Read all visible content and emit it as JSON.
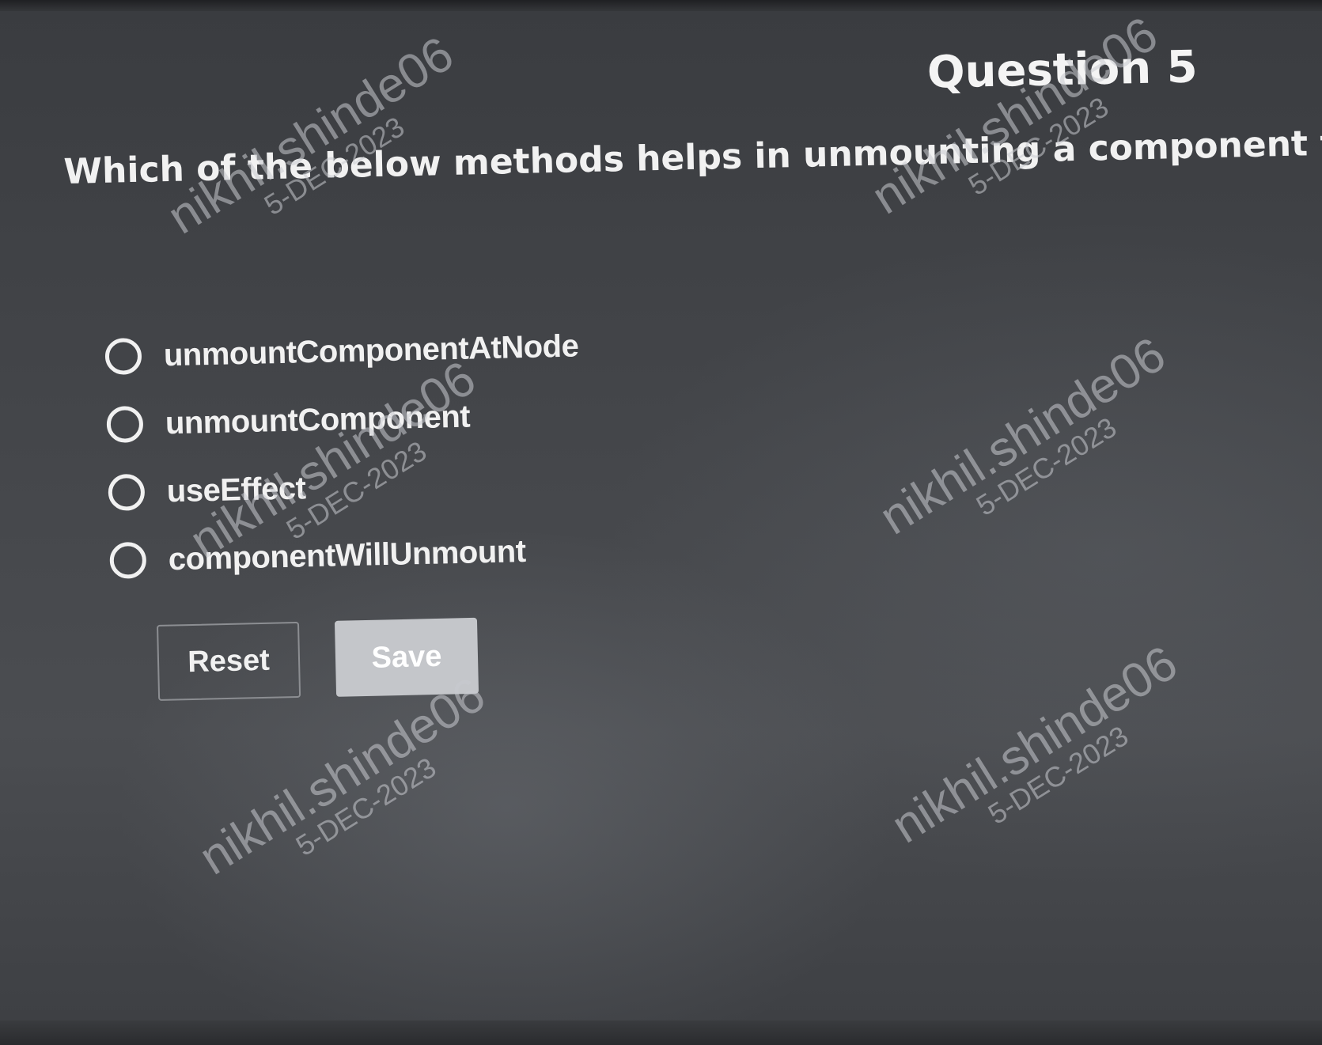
{
  "question": {
    "heading": "Question 5",
    "text": "Which of the below methods helps in unmounting a component from the DOM"
  },
  "options": [
    {
      "label": "unmountComponentAtNode",
      "selected": false
    },
    {
      "label": "unmountComponent",
      "selected": false
    },
    {
      "label": "useEffect",
      "selected": false
    },
    {
      "label": "componentWillUnmount",
      "selected": false
    }
  ],
  "buttons": {
    "reset_label": "Reset",
    "save_label": "Save"
  },
  "watermark": {
    "name": "nikhil.shinde06",
    "date": "5-DEC-2023"
  },
  "colors": {
    "background": "#45474b",
    "text": "#f1f1f1",
    "save_button": "#c4c6ca",
    "reset_border": "#8c8e92"
  }
}
